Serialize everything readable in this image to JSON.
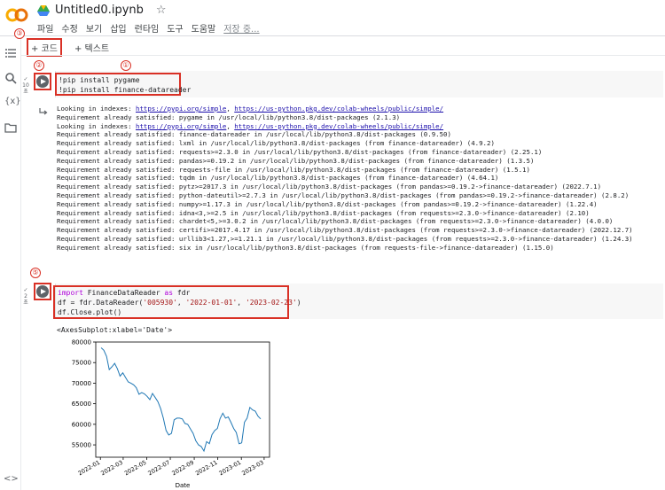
{
  "header": {
    "title": "Untitled0.ipynb",
    "menu": [
      "파일",
      "수정",
      "보기",
      "삽입",
      "런타임",
      "도구",
      "도움말"
    ],
    "saving": "저장 중..."
  },
  "toolbar": {
    "code_label": "+ 코드",
    "text_label": "+ 텍스트"
  },
  "annotations": [
    "①",
    "②",
    "③",
    "④",
    "⑤"
  ],
  "cell1": {
    "exec_time": "10",
    "exec_unit": "초",
    "code": [
      "!pip install pygame",
      "!pip install finance-datareader"
    ],
    "output": [
      {
        "t": "Looking in indexes: ",
        "l1": "https://pypi.org/simple",
        "m": ", ",
        "l2": "https://us-python.pkg.dev/colab-wheels/public/simple/"
      },
      {
        "t": "Requirement already satisfied: pygame in /usr/local/lib/python3.8/dist-packages (2.1.3)"
      },
      {
        "t": "Looking in indexes: ",
        "l1": "https://pypi.org/simple",
        "m": ", ",
        "l2": "https://us-python.pkg.dev/colab-wheels/public/simple/"
      },
      {
        "t": "Requirement already satisfied: finance-datareader in /usr/local/lib/python3.8/dist-packages (0.9.50)"
      },
      {
        "t": "Requirement already satisfied: lxml in /usr/local/lib/python3.8/dist-packages (from finance-datareader) (4.9.2)"
      },
      {
        "t": "Requirement already satisfied: requests>=2.3.0 in /usr/local/lib/python3.8/dist-packages (from finance-datareader) (2.25.1)"
      },
      {
        "t": "Requirement already satisfied: pandas>=0.19.2 in /usr/local/lib/python3.8/dist-packages (from finance-datareader) (1.3.5)"
      },
      {
        "t": "Requirement already satisfied: requests-file in /usr/local/lib/python3.8/dist-packages (from finance-datareader) (1.5.1)"
      },
      {
        "t": "Requirement already satisfied: tqdm in /usr/local/lib/python3.8/dist-packages (from finance-datareader) (4.64.1)"
      },
      {
        "t": "Requirement already satisfied: pytz>=2017.3 in /usr/local/lib/python3.8/dist-packages (from pandas>=0.19.2->finance-datareader) (2022.7.1)"
      },
      {
        "t": "Requirement already satisfied: python-dateutil>=2.7.3 in /usr/local/lib/python3.8/dist-packages (from pandas>=0.19.2->finance-datareader) (2.8.2)"
      },
      {
        "t": "Requirement already satisfied: numpy>=1.17.3 in /usr/local/lib/python3.8/dist-packages (from pandas>=0.19.2->finance-datareader) (1.22.4)"
      },
      {
        "t": "Requirement already satisfied: idna<3,>=2.5 in /usr/local/lib/python3.8/dist-packages (from requests>=2.3.0->finance-datareader) (2.10)"
      },
      {
        "t": "Requirement already satisfied: chardet<5,>=3.0.2 in /usr/local/lib/python3.8/dist-packages (from requests>=2.3.0->finance-datareader) (4.0.0)"
      },
      {
        "t": "Requirement already satisfied: certifi>=2017.4.17 in /usr/local/lib/python3.8/dist-packages (from requests>=2.3.0->finance-datareader) (2022.12.7)"
      },
      {
        "t": "Requirement already satisfied: urllib3<1.27,>=1.21.1 in /usr/local/lib/python3.8/dist-packages (from requests>=2.3.0->finance-datareader) (1.24.3)"
      },
      {
        "t": "Requirement already satisfied: six in /usr/local/lib/python3.8/dist-packages (from requests-file->finance-datareader) (1.15.0)"
      }
    ]
  },
  "cell2": {
    "exec_time": "2",
    "exec_unit": "초",
    "code_kw1": "import",
    "code_l1_rest": " FinanceDataReader ",
    "code_kw2": "as",
    "code_l1_end": " fdr",
    "code_l2_a": "df = fdr.DataReader(",
    "code_l2_s1": "'005930'",
    "code_l2_c1": ", ",
    "code_l2_s2": "'2022-01-01'",
    "code_l2_c2": ", ",
    "code_l2_s3": "'2023-02-23'",
    "code_l2_end": ")",
    "code_l3": "df.Close.plot()",
    "output_text": "<AxesSubplot:xlabel='Date'>"
  },
  "chart_data": {
    "type": "line",
    "xlabel": "Date",
    "ylabel": "",
    "ylim": [
      52000,
      80000
    ],
    "y_ticks": [
      55000,
      60000,
      65000,
      70000,
      75000,
      80000
    ],
    "x_ticks": [
      "2022-01",
      "2022-03",
      "2022-05",
      "2022-07",
      "2022-09",
      "2022-11",
      "2023-01",
      "2023-03"
    ],
    "color": "#1f77b4",
    "series": [
      {
        "x": [
          "2022-01-03",
          "2022-01-10",
          "2022-01-17",
          "2022-01-24",
          "2022-01-31",
          "2022-02-07",
          "2022-02-14",
          "2022-02-21",
          "2022-02-28",
          "2022-03-07",
          "2022-03-14",
          "2022-03-21",
          "2022-03-28",
          "2022-04-04",
          "2022-04-11",
          "2022-04-18",
          "2022-04-25",
          "2022-05-02",
          "2022-05-09",
          "2022-05-16",
          "2022-05-23",
          "2022-05-30",
          "2022-06-06",
          "2022-06-13",
          "2022-06-20",
          "2022-06-27",
          "2022-07-04",
          "2022-07-11",
          "2022-07-18",
          "2022-07-25",
          "2022-08-01",
          "2022-08-08",
          "2022-08-15",
          "2022-08-22",
          "2022-08-29",
          "2022-09-05",
          "2022-09-12",
          "2022-09-19",
          "2022-09-26",
          "2022-10-03",
          "2022-10-10",
          "2022-10-17",
          "2022-10-24",
          "2022-10-31",
          "2022-11-07",
          "2022-11-14",
          "2022-11-21",
          "2022-11-28",
          "2022-12-05",
          "2022-12-12",
          "2022-12-19",
          "2022-12-26",
          "2023-01-02",
          "2023-01-09",
          "2023-01-16",
          "2023-01-23",
          "2023-01-30",
          "2023-02-06",
          "2023-02-13",
          "2023-02-20"
        ],
        "values": [
          78600,
          78000,
          76500,
          73300,
          74000,
          74800,
          73500,
          71700,
          72500,
          71400,
          70300,
          70000,
          69600,
          68900,
          67300,
          67700,
          67400,
          66800,
          66000,
          67500,
          66500,
          65500,
          63800,
          61500,
          58500,
          57400,
          57800,
          61100,
          61500,
          61500,
          61300,
          60200,
          60000,
          58900,
          57800,
          56000,
          55000,
          54600,
          53500,
          55800,
          55300,
          57500,
          58500,
          59000,
          61400,
          62700,
          61500,
          61800,
          60500,
          59000,
          58000,
          55300,
          55500,
          60500,
          61500,
          64100,
          63500,
          63200,
          62000,
          61300
        ]
      }
    ]
  }
}
